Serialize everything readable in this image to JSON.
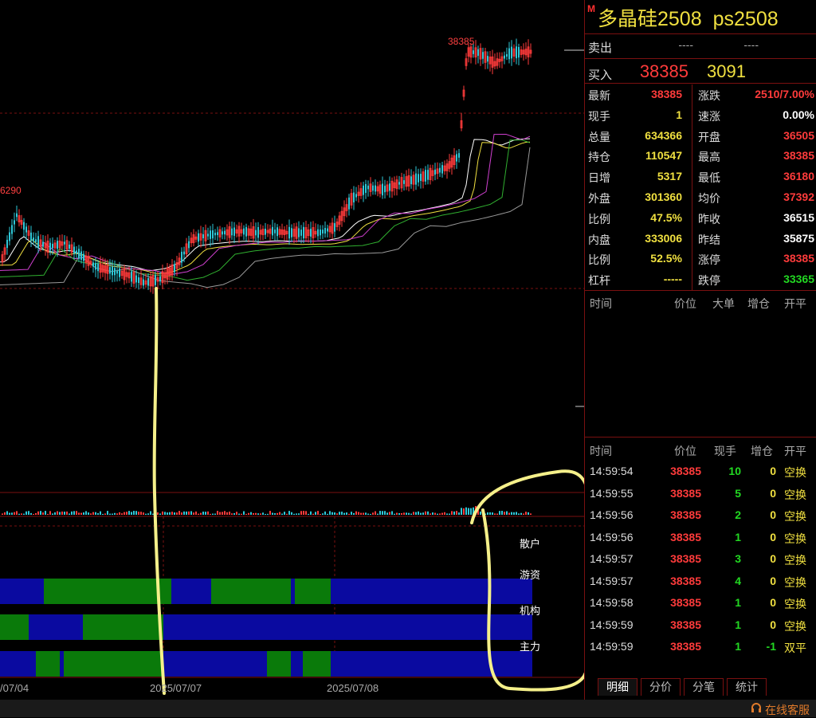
{
  "instrument": {
    "badge": "M",
    "name": "多晶硅2508",
    "code": "ps2508"
  },
  "orderbook": {
    "sell_label": "卖出",
    "sell_price": "----",
    "sell_qty": "----",
    "buy_label": "买入",
    "buy_price": "38385",
    "buy_qty": "3091"
  },
  "stats": [
    {
      "l1": "最新",
      "v1": "38385",
      "c1": "#ff3b3b",
      "l2": "涨跌",
      "v2": "2510/7.00%",
      "c2": "#ff3b3b"
    },
    {
      "l1": "现手",
      "v1": "1",
      "c1": "#f0e040",
      "l2": "速涨",
      "v2": "0.00%",
      "c2": "#ffffff"
    },
    {
      "l1": "总量",
      "v1": "634366",
      "c1": "#f0e040",
      "l2": "开盘",
      "v2": "36505",
      "c2": "#ff3b3b"
    },
    {
      "l1": "持仓",
      "v1": "110547",
      "c1": "#f0e040",
      "l2": "最高",
      "v2": "38385",
      "c2": "#ff3b3b"
    },
    {
      "l1": "日增",
      "v1": "5317",
      "c1": "#f0e040",
      "l2": "最低",
      "v2": "36180",
      "c2": "#ff3b3b"
    },
    {
      "l1": "外盘",
      "v1": "301360",
      "c1": "#f0e040",
      "l2": "均价",
      "v2": "37392",
      "c2": "#ff3b3b"
    },
    {
      "l1": "比例",
      "v1": "47.5%",
      "c1": "#f0e040",
      "l2": "昨收",
      "v2": "36515",
      "c2": "#ffffff"
    },
    {
      "l1": "内盘",
      "v1": "333006",
      "c1": "#f0e040",
      "l2": "昨结",
      "v2": "35875",
      "c2": "#ffffff"
    },
    {
      "l1": "比例",
      "v1": "52.5%",
      "c1": "#f0e040",
      "l2": "涨停",
      "v2": "38385",
      "c2": "#ff3b3b"
    },
    {
      "l1": "杠杆",
      "v1": "-----",
      "c1": "#f0e040",
      "l2": "跌停",
      "v2": "33365",
      "c2": "#22d822"
    }
  ],
  "big_order_header": [
    "时间",
    "价位",
    "大单",
    "增仓",
    "开平"
  ],
  "tick_header": [
    "时间",
    "价位",
    "现手",
    "增仓",
    "开平"
  ],
  "ticks": [
    {
      "time": "14:59:54",
      "price": "38385",
      "qty": "10",
      "oi": "0",
      "type": "空换"
    },
    {
      "time": "14:59:55",
      "price": "38385",
      "qty": "5",
      "oi": "0",
      "type": "空换"
    },
    {
      "time": "14:59:56",
      "price": "38385",
      "qty": "2",
      "oi": "0",
      "type": "空换"
    },
    {
      "time": "14:59:56",
      "price": "38385",
      "qty": "1",
      "oi": "0",
      "type": "空换"
    },
    {
      "time": "14:59:57",
      "price": "38385",
      "qty": "3",
      "oi": "0",
      "type": "空换"
    },
    {
      "time": "14:59:57",
      "price": "38385",
      "qty": "4",
      "oi": "0",
      "type": "空换"
    },
    {
      "time": "14:59:58",
      "price": "38385",
      "qty": "1",
      "oi": "0",
      "type": "空换"
    },
    {
      "time": "14:59:59",
      "price": "38385",
      "qty": "1",
      "oi": "0",
      "type": "空换"
    },
    {
      "time": "14:59:59",
      "price": "38385",
      "qty": "1",
      "oi": "-1",
      "type": "双平"
    }
  ],
  "tabs": [
    "明细",
    "分价",
    "分笔",
    "统计"
  ],
  "chart": {
    "high_label": "38385",
    "left_label": "6290",
    "dates": [
      "/07/04",
      "2025/07/07",
      "2025/07/08"
    ],
    "bar_labels": [
      "散户",
      "游资",
      "机构",
      "主力"
    ]
  },
  "colors": {
    "up": "#ff3b3b",
    "down": "#2ec8d8",
    "bar_blue": "#0a0aa0",
    "bar_green": "#0a7a0a",
    "annotation": "#f5f08a"
  },
  "footer": {
    "service": "在线客服",
    "service_icon": "headset-icon"
  }
}
